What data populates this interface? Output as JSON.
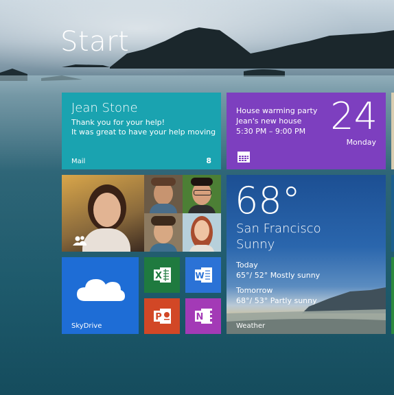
{
  "start_title": "Start",
  "mail": {
    "from": "Jean Stone",
    "line1": "Thank you for your help!",
    "line2": "It was great to have your help moving",
    "app_label": "Mail",
    "count": "8"
  },
  "calendar": {
    "event_title": "House warming party",
    "event_location": "Jean's new house",
    "event_time": "5:30 PM – 9:00 PM",
    "day_number": "24",
    "weekday": "Monday"
  },
  "weather": {
    "temperature": "68°",
    "city": "San Francisco",
    "condition": "Sunny",
    "today_label": "Today",
    "today_forecast": "65°/ 52° Mostly sunny",
    "tomorrow_label": "Tomorrow",
    "tomorrow_forecast": "68°/ 53° Partly sunny",
    "app_label": "Weather"
  },
  "skydrive": {
    "app_label": "SkyDrive"
  },
  "apps": {
    "excel_letter": "X",
    "word_letter": "W",
    "powerpoint_letter": "P",
    "onenote_letter": "N"
  },
  "colors": {
    "mail": "#1aa3b0",
    "calendar": "#7d3fbf",
    "skydrive": "#1e6dd6",
    "excel": "#1f7a3f",
    "word": "#2b72d6",
    "powerpoint": "#d24726",
    "onenote": "#a33ab6"
  }
}
